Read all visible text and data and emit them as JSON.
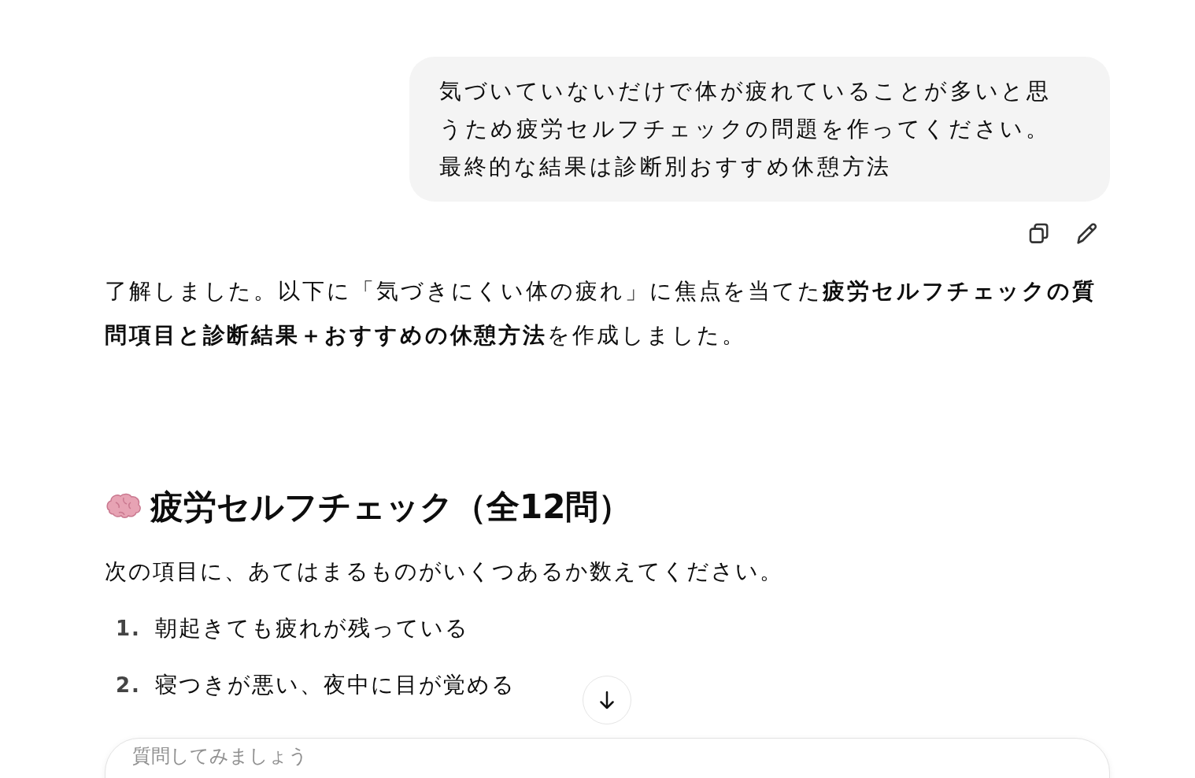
{
  "user_message": {
    "text": "気づいていないだけで体が疲れていることが多いと思うため疲労セルフチェックの問題を作ってください。最終的な結果は診断別おすすめ休憩方法"
  },
  "assistant_message": {
    "intro": "了解しました。以下に「気づきにくい体の疲れ」に焦点を当てた**疲労セルフチェックの質問項目と診断結果＋おすすめの休憩方法**を作成しました。",
    "heading": "疲労セルフチェック（全12問）",
    "instruction": "次の項目に、あてはまるものがいくつあるか数えてください。",
    "items": [
      {
        "number": "1.",
        "text": "朝起きても疲れが残っている"
      },
      {
        "number": "2.",
        "text": "寝つきが悪い、夜中に目が覚める"
      }
    ]
  },
  "composer": {
    "placeholder": "質問してみましょう"
  }
}
